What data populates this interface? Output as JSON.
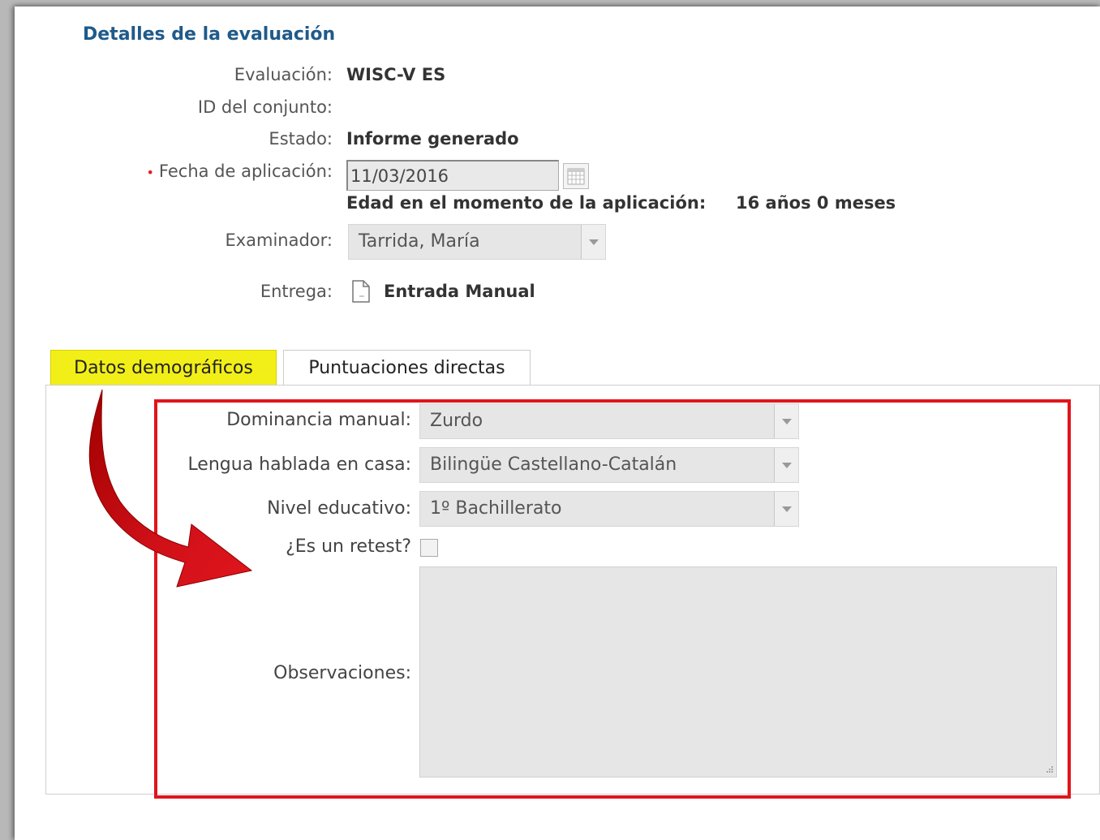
{
  "title": "Detalles de la evaluación",
  "fields": {
    "evaluacion": {
      "label": "Evaluación:",
      "value": "WISC-V ES"
    },
    "id_conjunto": {
      "label": "ID del conjunto:",
      "value": ""
    },
    "estado": {
      "label": "Estado:",
      "value": "Informe generado"
    },
    "fecha": {
      "required_mark": "•",
      "label": "Fecha de aplicación:",
      "value": "11/03/2016"
    },
    "edad": {
      "label": "Edad en el momento de la aplicación:",
      "value": "16 años 0 meses"
    },
    "examinador": {
      "label": "Examinador:",
      "value": "Tarrida, María"
    },
    "entrega": {
      "label": "Entrega:",
      "value": "Entrada Manual",
      "icon": "document-icon"
    }
  },
  "tabs": [
    {
      "label": "Datos demográficos",
      "active": true
    },
    {
      "label": "Puntuaciones directas",
      "active": false
    }
  ],
  "demographics": {
    "dominancia": {
      "label": "Dominancia manual:",
      "value": "Zurdo"
    },
    "lengua": {
      "label": "Lengua hablada en casa:",
      "value": "Bilingüe Castellano-Catalán"
    },
    "nivel": {
      "label": "Nivel educativo:",
      "value": "1º Bachillerato"
    },
    "retest": {
      "label": "¿Es un retest?",
      "checked": false
    },
    "observaciones": {
      "label": "Observaciones:",
      "value": ""
    }
  },
  "colors": {
    "title": "#1f5a8a",
    "tab_highlight": "#f2ef18",
    "annotation_red": "#e0151c",
    "arrow_dark_red": "#a00000"
  }
}
